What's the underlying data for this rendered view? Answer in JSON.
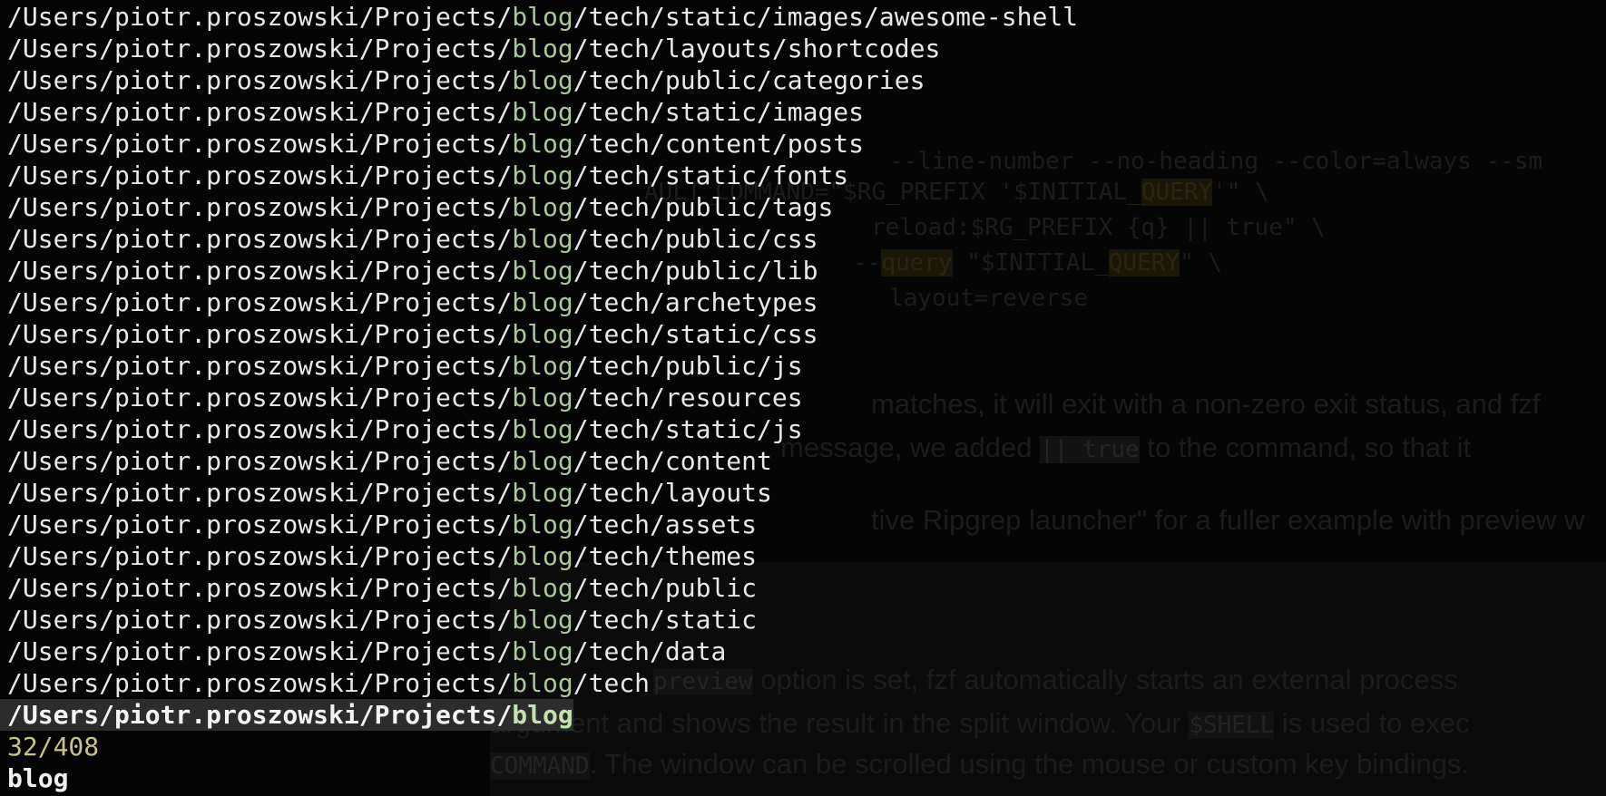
{
  "match_color": "#a9c79b",
  "counter_color": "#c8c28a",
  "selected_bg": "#2c2c2c",
  "results": [
    {
      "prefix": "/Users/piotr.proszowski/Projects/",
      "match": "blog",
      "suffix": "/tech/static/images/awesome-shell"
    },
    {
      "prefix": "/Users/piotr.proszowski/Projects/",
      "match": "blog",
      "suffix": "/tech/layouts/shortcodes"
    },
    {
      "prefix": "/Users/piotr.proszowski/Projects/",
      "match": "blog",
      "suffix": "/tech/public/categories"
    },
    {
      "prefix": "/Users/piotr.proszowski/Projects/",
      "match": "blog",
      "suffix": "/tech/static/images"
    },
    {
      "prefix": "/Users/piotr.proszowski/Projects/",
      "match": "blog",
      "suffix": "/tech/content/posts"
    },
    {
      "prefix": "/Users/piotr.proszowski/Projects/",
      "match": "blog",
      "suffix": "/tech/static/fonts"
    },
    {
      "prefix": "/Users/piotr.proszowski/Projects/",
      "match": "blog",
      "suffix": "/tech/public/tags"
    },
    {
      "prefix": "/Users/piotr.proszowski/Projects/",
      "match": "blog",
      "suffix": "/tech/public/css"
    },
    {
      "prefix": "/Users/piotr.proszowski/Projects/",
      "match": "blog",
      "suffix": "/tech/public/lib"
    },
    {
      "prefix": "/Users/piotr.proszowski/Projects/",
      "match": "blog",
      "suffix": "/tech/archetypes"
    },
    {
      "prefix": "/Users/piotr.proszowski/Projects/",
      "match": "blog",
      "suffix": "/tech/static/css"
    },
    {
      "prefix": "/Users/piotr.proszowski/Projects/",
      "match": "blog",
      "suffix": "/tech/public/js"
    },
    {
      "prefix": "/Users/piotr.proszowski/Projects/",
      "match": "blog",
      "suffix": "/tech/resources"
    },
    {
      "prefix": "/Users/piotr.proszowski/Projects/",
      "match": "blog",
      "suffix": "/tech/static/js"
    },
    {
      "prefix": "/Users/piotr.proszowski/Projects/",
      "match": "blog",
      "suffix": "/tech/content"
    },
    {
      "prefix": "/Users/piotr.proszowski/Projects/",
      "match": "blog",
      "suffix": "/tech/layouts"
    },
    {
      "prefix": "/Users/piotr.proszowski/Projects/",
      "match": "blog",
      "suffix": "/tech/assets"
    },
    {
      "prefix": "/Users/piotr.proszowski/Projects/",
      "match": "blog",
      "suffix": "/tech/themes"
    },
    {
      "prefix": "/Users/piotr.proszowski/Projects/",
      "match": "blog",
      "suffix": "/tech/public"
    },
    {
      "prefix": "/Users/piotr.proszowski/Projects/",
      "match": "blog",
      "suffix": "/tech/static"
    },
    {
      "prefix": "/Users/piotr.proszowski/Projects/",
      "match": "blog",
      "suffix": "/tech/data"
    },
    {
      "prefix": "/Users/piotr.proszowski/Projects/",
      "match": "blog",
      "suffix": "/tech"
    }
  ],
  "selected": {
    "prefix": "/Users/piotr.proszowski/Projects/",
    "match": "blog",
    "suffix": ""
  },
  "counter": "32/408",
  "query": "blog",
  "background_doc": {
    "code_lines": [
      "--line-number --no-heading --color=always --sm",
      "AULT_COMMAND=\"$RG_PREFIX '$INITIAL_",
      "QUERY",
      "'\" \\",
      "reload:$RG_PREFIX {q} || true\" \\",
      "--",
      "query",
      " \"$INITIAL_",
      "\" \\",
      "layout=reverse"
    ],
    "prose_lines": [
      "matches, it will exit with a non-zero exit status, and fzf",
      "message, we added",
      "|| true",
      "to the command, so that it",
      "tive Ripgrep launcher\" for a fuller example with preview w",
      "preview",
      "option is set, fzf automatically starts an external process",
      "argument and shows the result in the split window. Your",
      "$SHELL",
      "is used to exec",
      "COMMAND",
      ". The window can be scrolled using the mouse or custom key bindings."
    ]
  }
}
